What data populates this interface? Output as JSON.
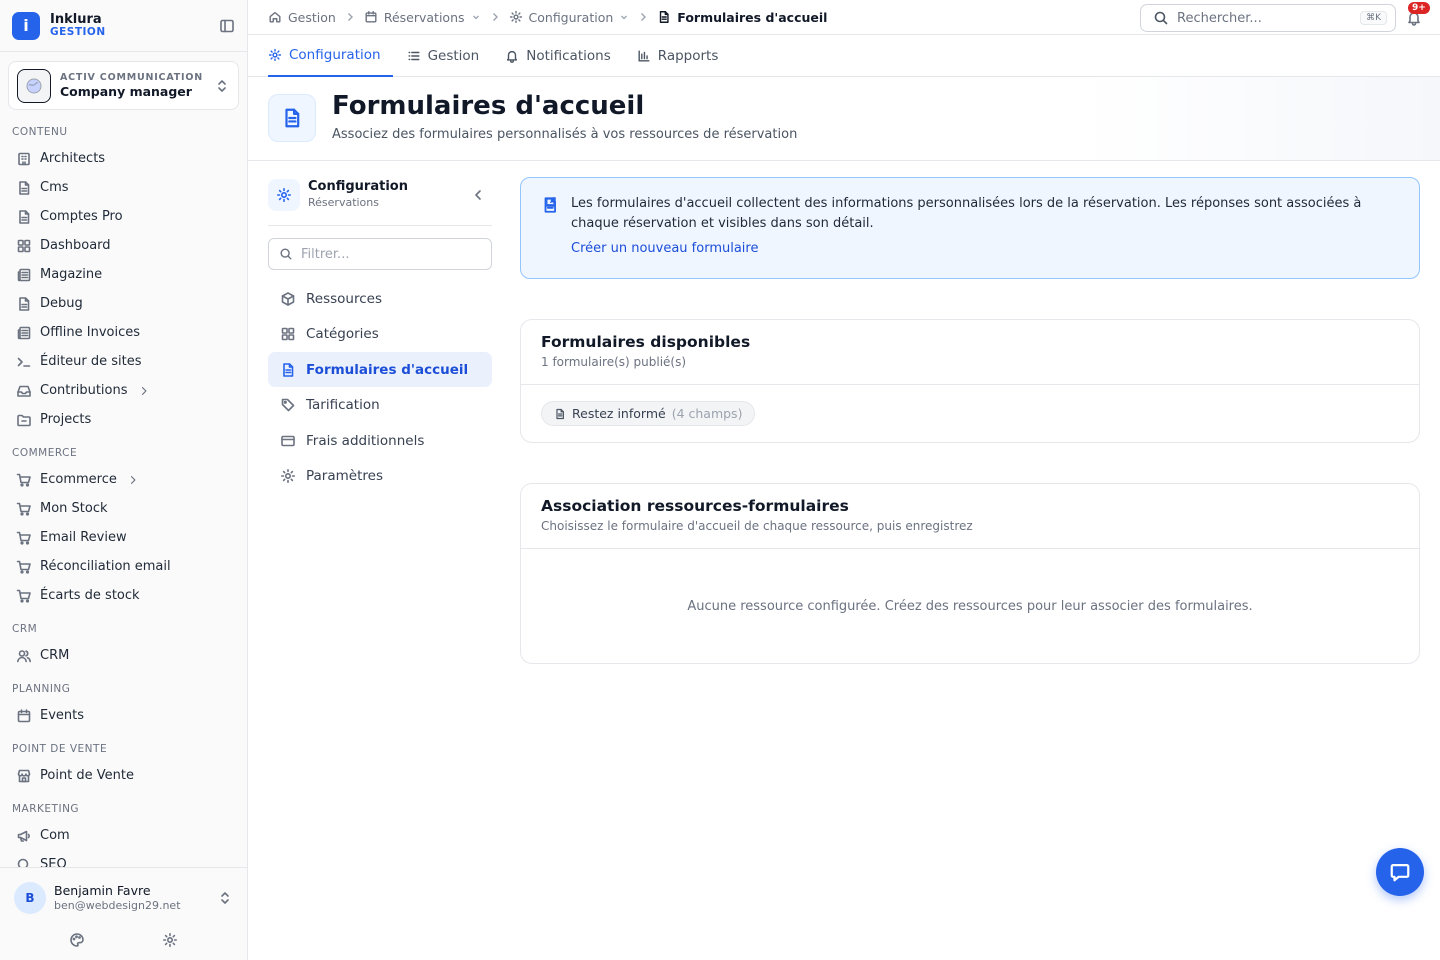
{
  "brand": {
    "name": "Inklura",
    "sub": "GESTION"
  },
  "org": {
    "kicker": "ACTIV COMMUNICATION",
    "name": "Company manager"
  },
  "sidebar": {
    "sections": [
      {
        "label": "CONTENU",
        "items": [
          {
            "label": "Architects",
            "icon": "building-icon"
          },
          {
            "label": "Cms",
            "icon": "file-icon"
          },
          {
            "label": "Comptes Pro",
            "icon": "file-icon"
          },
          {
            "label": "Dashboard",
            "icon": "grid-icon"
          },
          {
            "label": "Magazine",
            "icon": "newspaper-icon"
          },
          {
            "label": "Debug",
            "icon": "file-icon"
          },
          {
            "label": "Offline Invoices",
            "icon": "newspaper-icon"
          },
          {
            "label": "Éditeur de sites",
            "icon": "terminal-icon"
          },
          {
            "label": "Contributions",
            "icon": "inbox-icon",
            "has_children": true
          },
          {
            "label": "Projects",
            "icon": "folder-icon"
          }
        ]
      },
      {
        "label": "COMMERCE",
        "items": [
          {
            "label": "Ecommerce",
            "icon": "cart-icon",
            "has_children": true
          },
          {
            "label": "Mon Stock",
            "icon": "cart-icon"
          },
          {
            "label": "Email Review",
            "icon": "cart-icon"
          },
          {
            "label": "Réconciliation email",
            "icon": "cart-icon"
          },
          {
            "label": "Écarts de stock",
            "icon": "cart-icon"
          }
        ]
      },
      {
        "label": "CRM",
        "items": [
          {
            "label": "CRM",
            "icon": "users-icon"
          }
        ]
      },
      {
        "label": "PLANNING",
        "items": [
          {
            "label": "Events",
            "icon": "calendar-icon"
          }
        ]
      },
      {
        "label": "POINT DE VENTE",
        "items": [
          {
            "label": "Point de Vente",
            "icon": "store-icon"
          }
        ]
      },
      {
        "label": "MARKETING",
        "items": [
          {
            "label": "Com",
            "icon": "megaphone-icon"
          },
          {
            "label": "SEO",
            "icon": "search-icon"
          }
        ]
      }
    ]
  },
  "user": {
    "initial": "B",
    "name": "Benjamin Favre",
    "email": "ben@webdesign29.net"
  },
  "breadcrumb": {
    "home": "Gestion",
    "reservations": "Réservations",
    "configuration": "Configuration",
    "current": "Formulaires d'accueil"
  },
  "search": {
    "placeholder": "Rechercher...",
    "shortcut": "⌘K"
  },
  "notifications": {
    "badge": "9+"
  },
  "tabs": [
    {
      "label": "Configuration",
      "active": true
    },
    {
      "label": "Gestion"
    },
    {
      "label": "Notifications"
    },
    {
      "label": "Rapports"
    }
  ],
  "header": {
    "title": "Formulaires d'accueil",
    "subtitle": "Associez des formulaires personnalisés à vos ressources de réservation"
  },
  "subnav": {
    "title": "Configuration",
    "subtitle": "Réservations",
    "filter_placeholder": "Filtrer...",
    "items": [
      {
        "label": "Ressources"
      },
      {
        "label": "Catégories"
      },
      {
        "label": "Formulaires d'accueil",
        "active": true
      },
      {
        "label": "Tarification"
      },
      {
        "label": "Frais additionnels"
      },
      {
        "label": "Paramètres"
      }
    ]
  },
  "info": {
    "text": "Les formulaires d'accueil collectent des informations personnalisées lors de la réservation. Les réponses sont associées à chaque réservation et visibles dans son détail.",
    "link": "Créer un nouveau formulaire"
  },
  "forms_card": {
    "title": "Formulaires disponibles",
    "subtitle": "1 formulaire(s) publié(s)",
    "forms": [
      {
        "name": "Restez informé",
        "count": "(4 champs)"
      }
    ]
  },
  "assoc_card": {
    "title": "Association ressources-formulaires",
    "subtitle": "Choisissez le formulaire d'accueil de chaque ressource, puis enregistrez",
    "empty": "Aucune ressource configurée. Créez des ressources pour leur associer des formulaires."
  }
}
